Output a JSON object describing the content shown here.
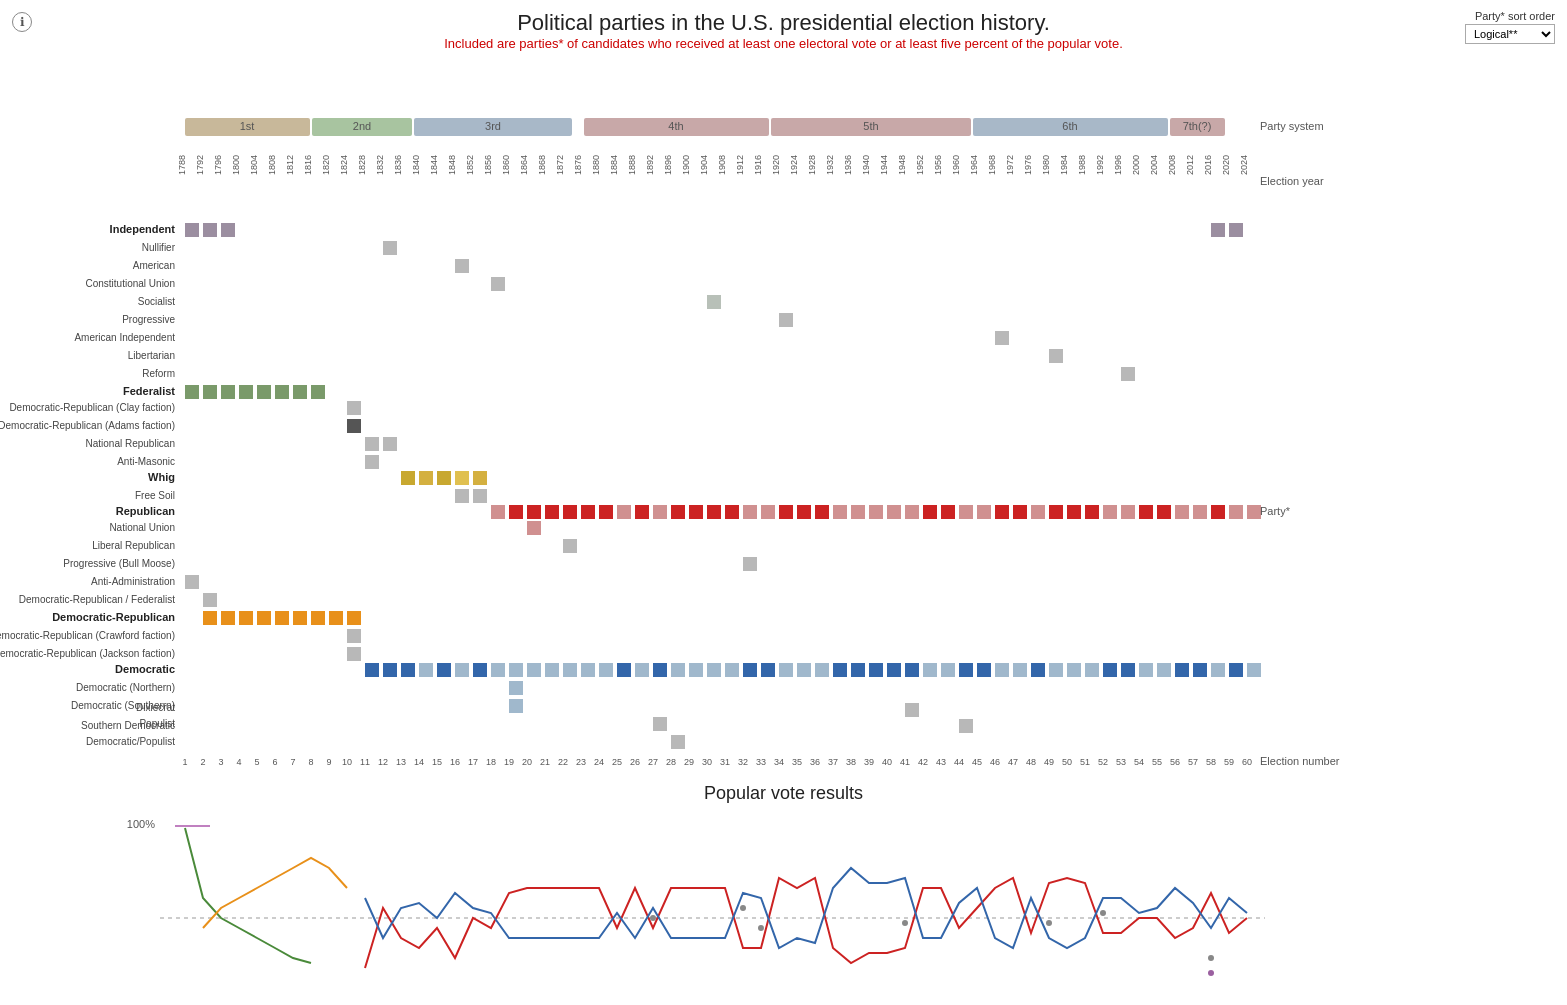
{
  "header": {
    "title": "Political parties in the U.S. presidential election history.",
    "subtitle": "Included are parties* of candidates who received at least one electoral vote or at least five percent of the popular vote.",
    "info_icon": "ℹ",
    "sort_label": "Party* sort order",
    "sort_option": "Logical**"
  },
  "chart": {
    "party_system_label": "Party system",
    "election_year_label": "Election year",
    "election_number_label": "Election number",
    "party_label": "Party*"
  }
}
